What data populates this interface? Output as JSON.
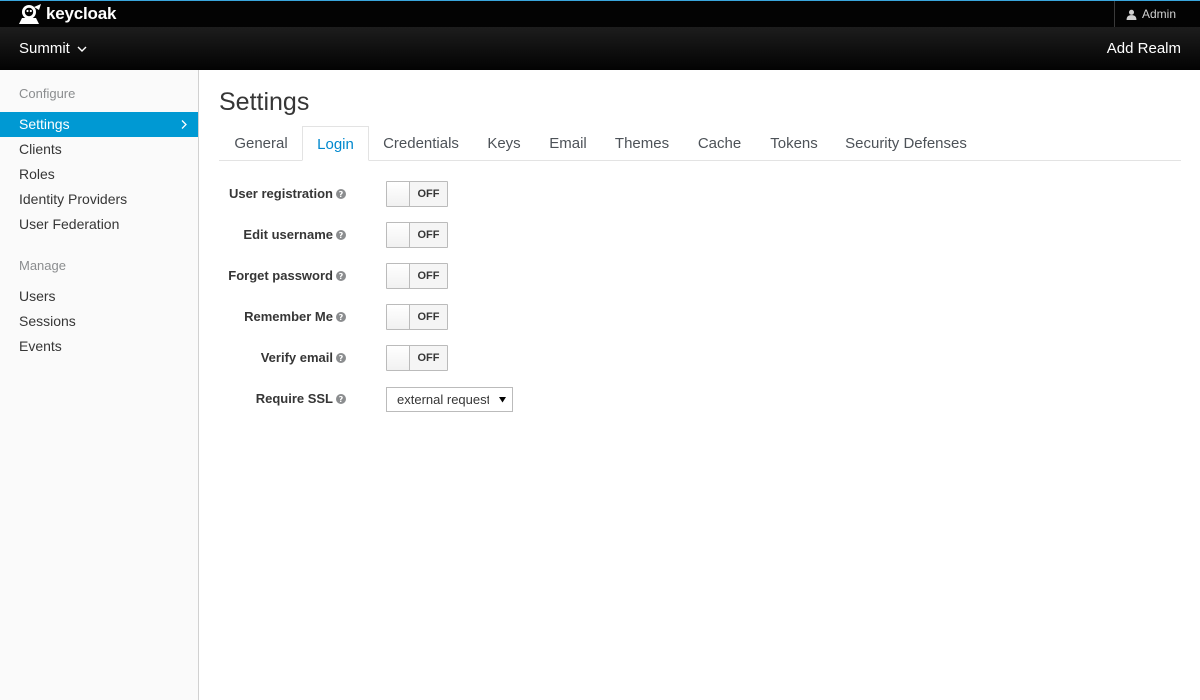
{
  "brand": {
    "name": "keycloak"
  },
  "topbar": {
    "user_label": "Admin"
  },
  "realmbar": {
    "realm_name": "Summit",
    "add_realm_label": "Add Realm"
  },
  "sidebar": {
    "configure_heading": "Configure",
    "configure_items": [
      {
        "label": "Settings",
        "active": true
      },
      {
        "label": "Clients"
      },
      {
        "label": "Roles"
      },
      {
        "label": "Identity Providers"
      },
      {
        "label": "User Federation"
      }
    ],
    "manage_heading": "Manage",
    "manage_items": [
      {
        "label": "Users"
      },
      {
        "label": "Sessions"
      },
      {
        "label": "Events"
      }
    ]
  },
  "main": {
    "title": "Settings",
    "tabs": [
      {
        "label": "General"
      },
      {
        "label": "Login",
        "active": true
      },
      {
        "label": "Credentials"
      },
      {
        "label": "Keys"
      },
      {
        "label": "Email"
      },
      {
        "label": "Themes"
      },
      {
        "label": "Cache"
      },
      {
        "label": "Tokens"
      },
      {
        "label": "Security Defenses"
      }
    ],
    "form": {
      "user_registration": {
        "label": "User registration",
        "state": "OFF"
      },
      "edit_username": {
        "label": "Edit username",
        "state": "OFF"
      },
      "forget_password": {
        "label": "Forget password",
        "state": "OFF"
      },
      "remember_me": {
        "label": "Remember Me",
        "state": "OFF"
      },
      "verify_email": {
        "label": "Verify email",
        "state": "OFF"
      },
      "require_ssl": {
        "label": "Require SSL",
        "value": "external requests"
      }
    }
  },
  "colors": {
    "accent": "#0099d3",
    "active_tab": "#0088ce",
    "topbar_border": "#39a5dc",
    "header_bg": "#030303"
  },
  "icons": {
    "logo": "keycloak-logo-icon",
    "user": "user-icon",
    "realm_dropdown": "chevron-down-icon",
    "active_nav": "chevron-right-icon",
    "help": "question-circle-icon",
    "select_caret": "caret-down-icon"
  }
}
